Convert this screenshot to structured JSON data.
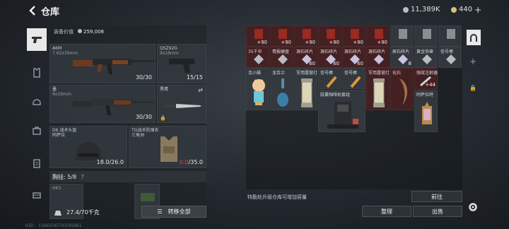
{
  "header": {
    "title": "仓库"
  },
  "currency": {
    "silver": "11,389K",
    "gold": "440"
  },
  "loadout": {
    "equipment_value_label": "装备价值",
    "equipment_value": "259,008",
    "primary": {
      "name": "AKM",
      "ammo": "7.62x39mm",
      "count": "30/30"
    },
    "pistol": {
      "name": "QSZ92G",
      "ammo": "9x19mm",
      "count": "15/15"
    },
    "secondary": {
      "name": "墨",
      "ammo": "9x19mm",
      "count": "30/30"
    },
    "melee": {
      "name": "黑鹰"
    },
    "helmet": {
      "name": "D6 战术头盔\n阿萨拉",
      "count": "18.0/26.0"
    },
    "armor": {
      "name": "TG战术防弹衣\n三角洲",
      "count_a": "0.0",
      "count_b": "/35.0"
    },
    "chest_rig": {
      "label": "胸挂: 5/8"
    },
    "weight": "27.4",
    "weight_max": "/70千克",
    "transfer_label": "转移全部"
  },
  "stash": {
    "row1": [
      {
        "label": "",
        "badge": "90"
      },
      {
        "label": "",
        "badge": "90"
      },
      {
        "label": "",
        "badge": "90"
      },
      {
        "label": "",
        "badge": "90"
      },
      {
        "label": "",
        "badge": "90"
      },
      {
        "label": "",
        "badge": "90"
      },
      {
        "label": "",
        "badge": ""
      },
      {
        "label": "",
        "badge": ""
      },
      {
        "label": "",
        "badge": ""
      }
    ],
    "row2": [
      {
        "label": "35千中",
        "badge": ""
      },
      {
        "label": "情报硬盘",
        "badge": ""
      },
      {
        "label": "源石碎片",
        "badge": "60"
      },
      {
        "label": "源石碎片",
        "badge": "60"
      },
      {
        "label": "源石碎片",
        "badge": "60"
      },
      {
        "label": "源石碎片",
        "badge": ""
      },
      {
        "label": "原石碎片",
        "badge": "8"
      },
      {
        "label": "黄金饰章",
        "badge": ""
      },
      {
        "label": "信号棒",
        "badge": ""
      }
    ],
    "row3": [
      {
        "label": "克小猫"
      },
      {
        "label": "龙舌兰"
      },
      {
        "label": "军用露营灯"
      },
      {
        "label": "信号棒"
      },
      {
        "label": "信号棒"
      },
      {
        "label": "军用露营灯"
      },
      {
        "label": "化石"
      },
      {
        "label": "强效注射器"
      }
    ],
    "coffee_label": "胶囊咖啡机套组",
    "statue_label": "阿萨拉特",
    "syringe_badge": "44",
    "hint": "特勤处升级仓库可增加容量",
    "goto_label": "前往",
    "sort_label": "整理",
    "sell_label": "出售"
  },
  "footer_id": "UID: 11665545703595861"
}
